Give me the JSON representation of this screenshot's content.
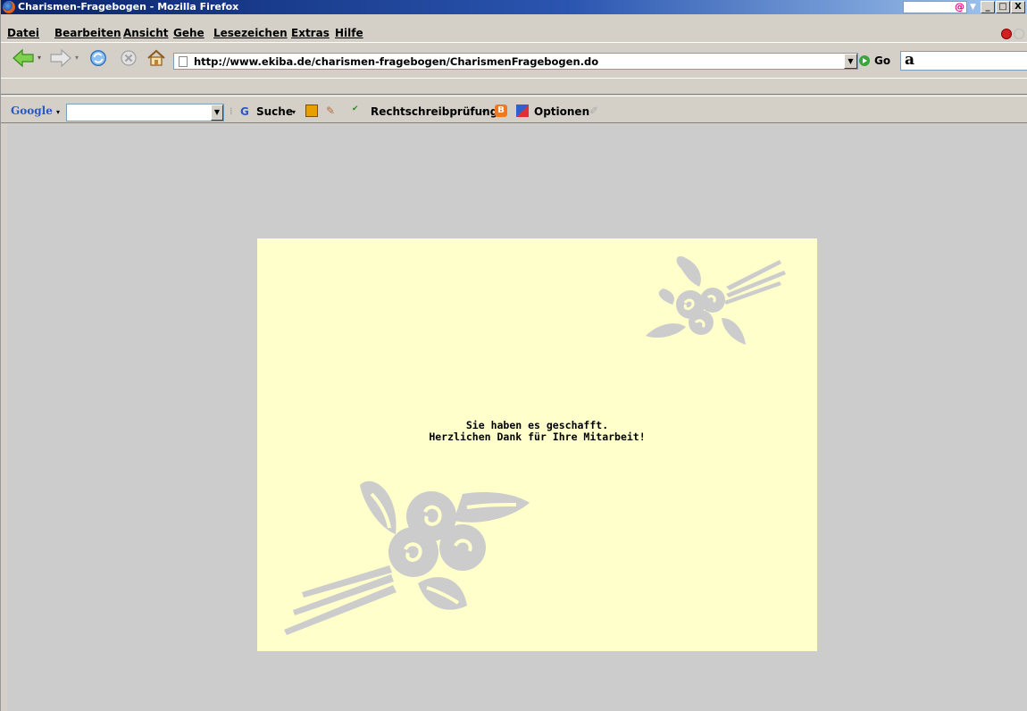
{
  "window": {
    "title": "Charismen-Fragebogen - Mozilla Firefox",
    "controls": [
      "_",
      "□",
      "X"
    ]
  },
  "menu": {
    "items": [
      "Datei",
      "Bearbeiten",
      "Ansicht",
      "Gehe",
      "Lesezeichen",
      "Extras",
      "Hilfe"
    ]
  },
  "navigation": {
    "url": "http://www.ekiba.de/charismen-fragebogen/CharismenFragebogen.do",
    "go_label": "Go",
    "amazon_label": "a"
  },
  "google_toolbar": {
    "logo": "Google",
    "search_value": "",
    "search_label": "Suche",
    "spellcheck_label": "Rechtschreibprüfung",
    "options_label": "Optionen"
  },
  "page": {
    "line1": "Sie haben es geschafft.",
    "line2": "Herzlichen Dank für Ihre Mitarbeit!",
    "background_color": "#ffffcc",
    "ornament_color": "#cccccc"
  }
}
